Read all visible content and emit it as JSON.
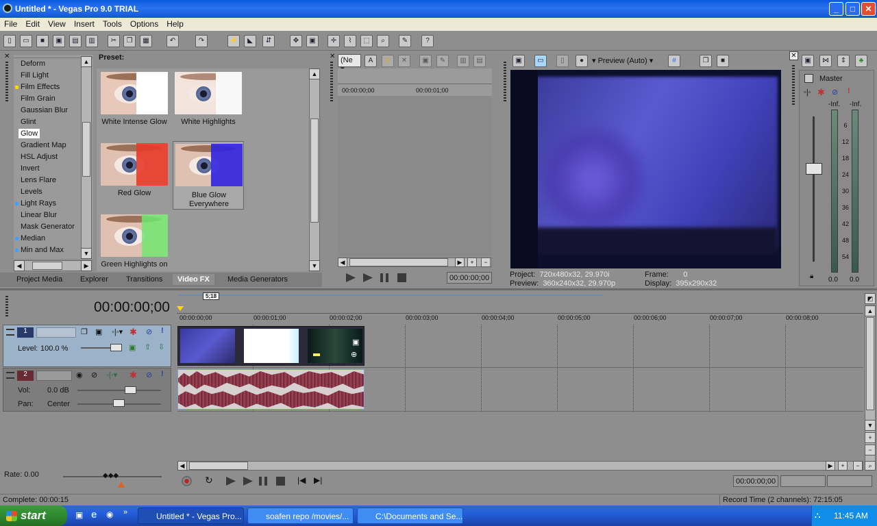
{
  "window": {
    "title": "Untitled * - Vegas Pro 9.0 TRIAL"
  },
  "menu": [
    "File",
    "Edit",
    "View",
    "Insert",
    "Tools",
    "Options",
    "Help"
  ],
  "fx": {
    "items": [
      "Deform",
      "Fill Light",
      "Film Effects",
      "Film Grain",
      "Gaussian Blur",
      "Glint",
      "Glow",
      "Gradient Map",
      "HSL Adjust",
      "Invert",
      "Lens Flare",
      "Levels",
      "Light Rays",
      "Linear Blur",
      "Mask Generator",
      "Median",
      "Min and Max"
    ],
    "selected": "Glow"
  },
  "preset": {
    "header": "Preset:",
    "tiles": [
      {
        "label": "White Intense Glow",
        "tint": "#ffffff"
      },
      {
        "label": "White Highlights",
        "tint": "#f4f4f4"
      },
      {
        "label": "Red Glow",
        "tint": "#e83a2a"
      },
      {
        "label": "Blue Glow Everywhere",
        "tint": "#3024e0"
      },
      {
        "label": "Green Highlights on",
        "tint": "#72e672"
      }
    ]
  },
  "tabs": [
    "Project Media",
    "Explorer",
    "Transitions",
    "Video FX",
    "Media Generators"
  ],
  "trimmer": {
    "dropdown": "(Ne",
    "t0": "00:00:00;00",
    "t1": "00:00:01;00",
    "timecode": "00:00:00;00"
  },
  "preview": {
    "mode": "Preview (Auto)",
    "project_label": "Project:",
    "project": "720x480x32, 29.970i",
    "preview_label": "Preview:",
    "preview": "360x240x32, 29.970p",
    "frame_label": "Frame:",
    "frame": "0",
    "display_label": "Display:",
    "display": "395x290x32"
  },
  "mixer": {
    "master": "Master",
    "left_db": "-Inf.",
    "right_db": "-Inf.",
    "scale": [
      "6",
      "12",
      "18",
      "24",
      "30",
      "36",
      "42",
      "48",
      "54"
    ],
    "left_val": "0.0",
    "right_val": "0.0"
  },
  "timeline": {
    "cursor": "00:00:00;00",
    "marker": "5;18",
    "ruler": [
      "00:00:00;00",
      "00:00:01;00",
      "00:00:02;00",
      "00:00:03;00",
      "00:00:04;00",
      "00:00:05;00",
      "00:00:06;00",
      "00:00:07;00",
      "00:00:08;00"
    ],
    "video_track": {
      "number": "1",
      "level_label": "Level:",
      "level": "100.0 %"
    },
    "audio_track": {
      "number": "2",
      "vol_label": "Vol:",
      "vol": "0.0 dB",
      "pan_label": "Pan:",
      "pan": "Center"
    },
    "rate": "Rate: 0.00",
    "transport_timecode": "00:00:00;00"
  },
  "status": {
    "left": "Complete: 00:00:15",
    "right": "Record Time (2 channels): 72:15:05"
  },
  "taskbar": {
    "start": "start",
    "tasks": [
      "Untitled * - Vegas Pro...",
      "soafen repo /movies/...",
      "C:\\Documents and Se..."
    ],
    "clock": "11:45 AM"
  },
  "colors": {
    "title": "#0a5ae0",
    "audio_wave": "#8a3a4a",
    "taskbar": "#245edb"
  }
}
